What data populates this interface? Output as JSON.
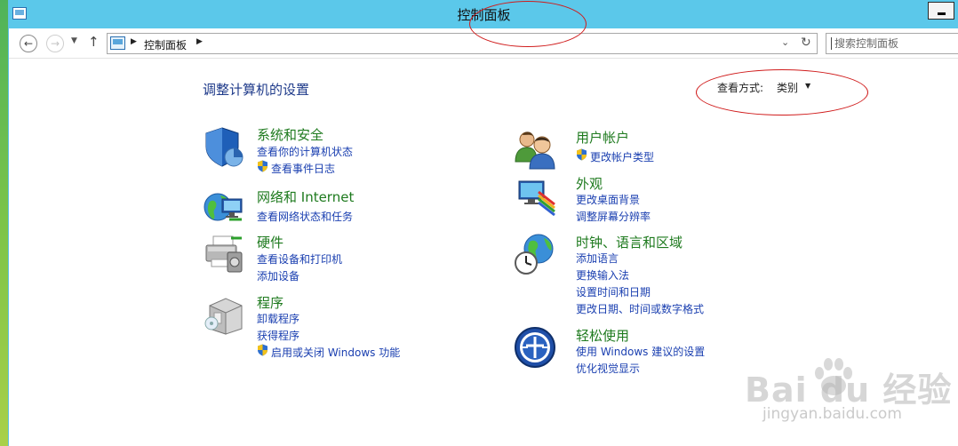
{
  "window": {
    "title": "控制面板"
  },
  "address_bar": {
    "crumb": "控制面板",
    "search_placeholder": "搜索控制面板"
  },
  "main": {
    "heading": "调整计算机的设置",
    "view_by_label": "查看方式:",
    "view_by_value": "类别"
  },
  "categories_left": [
    {
      "title": "系统和安全",
      "icon": "shield-icon",
      "links": [
        "查看你的计算机状态",
        "查看事件日志"
      ]
    },
    {
      "title": "网络和 Internet",
      "icon": "network-globe-icon",
      "links": [
        "查看网络状态和任务"
      ]
    },
    {
      "title": "硬件",
      "icon": "printer-icon",
      "links": [
        "查看设备和打印机",
        "添加设备"
      ]
    },
    {
      "title": "程序",
      "icon": "programs-box-icon",
      "links": [
        "卸载程序",
        "获得程序",
        "启用或关闭 Windows 功能"
      ]
    }
  ],
  "categories_right": [
    {
      "title": "用户帐户",
      "icon": "users-icon",
      "links": [
        "更改帐户类型"
      ]
    },
    {
      "title": "外观",
      "icon": "appearance-monitor-icon",
      "links": [
        "更改桌面背景",
        "调整屏幕分辨率"
      ]
    },
    {
      "title": "时钟、语言和区域",
      "icon": "globe-clock-icon",
      "links": [
        "添加语言",
        "更换输入法",
        "设置时间和日期",
        "更改日期、时间或数字格式"
      ]
    },
    {
      "title": "轻松使用",
      "icon": "ease-of-access-icon",
      "links": [
        "使用 Windows 建议的设置",
        "优化视觉显示"
      ]
    }
  ],
  "watermark": {
    "logo": "Bai du 经验",
    "url": "jingyan.baidu.com"
  },
  "colors": {
    "titlebar": "#5bc8ea",
    "category_title": "#1e7a1e",
    "link": "#1a3fb0",
    "heading": "#1e3a8a",
    "annotation": "#d01c1c"
  }
}
